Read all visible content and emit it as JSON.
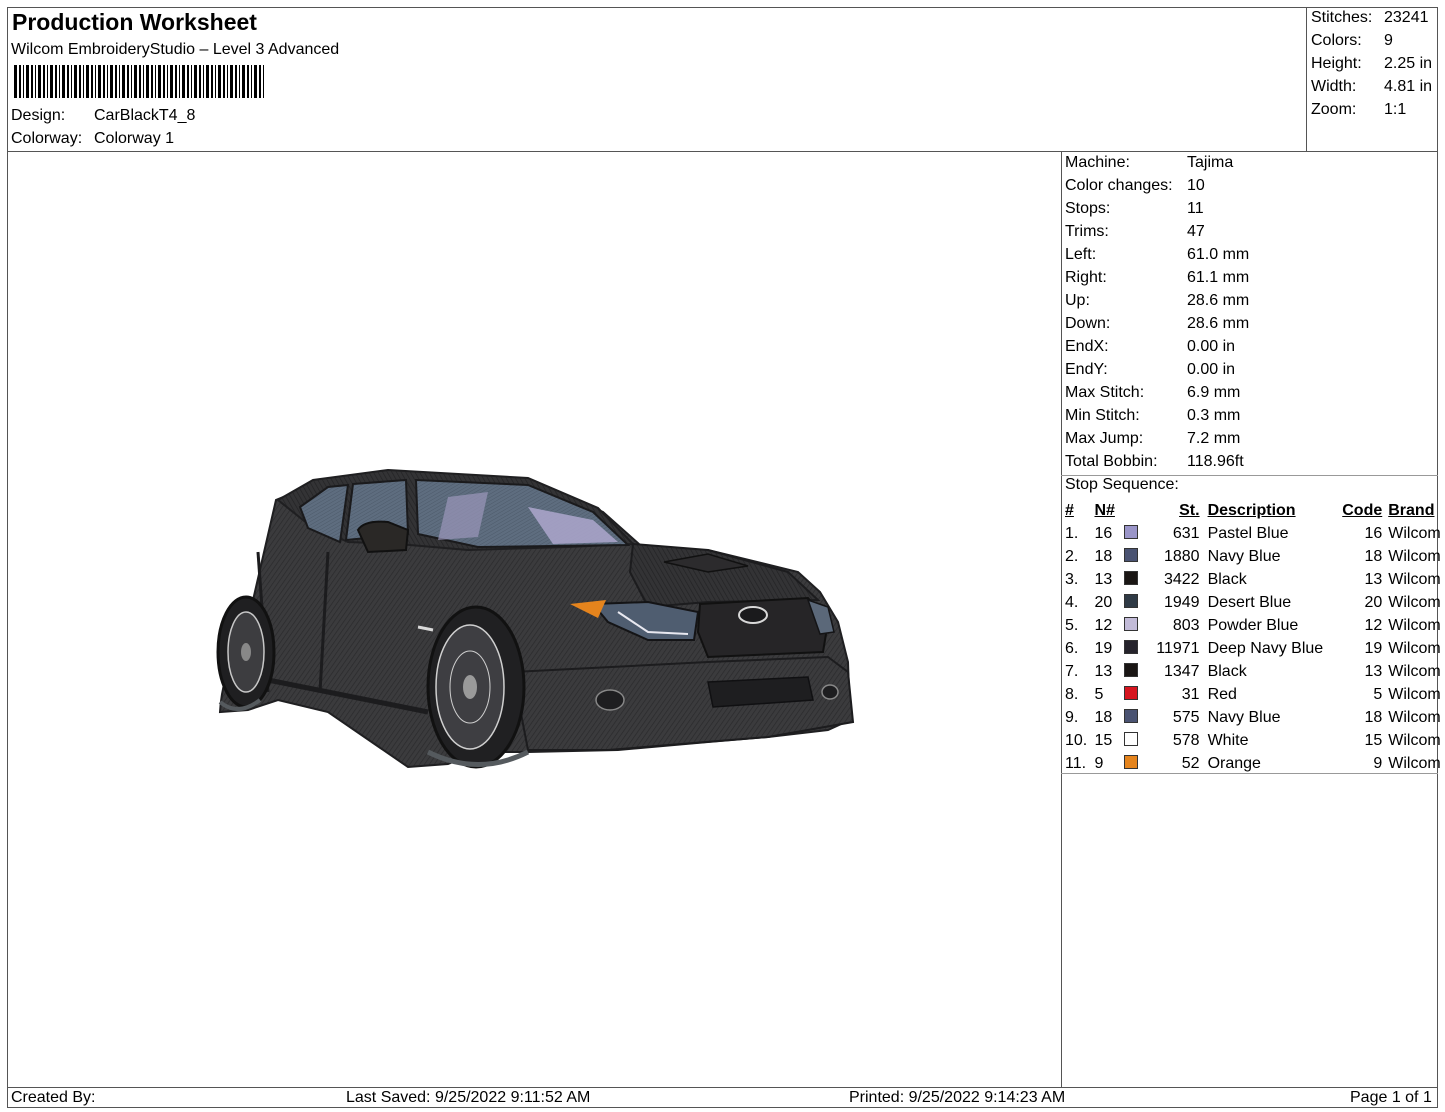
{
  "header": {
    "title": "Production Worksheet",
    "subtitle": "Wilcom EmbroideryStudio – Level 3 Advanced",
    "design_label": "Design:",
    "design_value": "CarBlackT4_8",
    "colorway_label": "Colorway:",
    "colorway_value": "Colorway 1"
  },
  "summary": [
    {
      "label": "Stitches:",
      "value": "23241"
    },
    {
      "label": "Colors:",
      "value": "9"
    },
    {
      "label": "Height:",
      "value": "2.25 in"
    },
    {
      "label": "Width:",
      "value": "4.81 in"
    },
    {
      "label": "Zoom:",
      "value": "1:1"
    }
  ],
  "machine_info": [
    {
      "label": "Machine:",
      "value": "Tajima"
    },
    {
      "label": "Color changes:",
      "value": "10"
    },
    {
      "label": "Stops:",
      "value": "11"
    },
    {
      "label": "Trims:",
      "value": "47"
    },
    {
      "label": "Left:",
      "value": "61.0 mm"
    },
    {
      "label": "Right:",
      "value": "61.1 mm"
    },
    {
      "label": "Up:",
      "value": "28.6 mm"
    },
    {
      "label": "Down:",
      "value": "28.6 mm"
    },
    {
      "label": "EndX:",
      "value": "0.00 in"
    },
    {
      "label": "EndY:",
      "value": "0.00 in"
    },
    {
      "label": "Max Stitch:",
      "value": "6.9 mm"
    },
    {
      "label": "Min Stitch:",
      "value": "0.3 mm"
    },
    {
      "label": "Max Jump:",
      "value": "7.2 mm"
    },
    {
      "label": "Total Bobbin:",
      "value": "118.96ft"
    }
  ],
  "stop_sequence": {
    "label": "Stop Sequence:",
    "headers": {
      "idx": "#",
      "n": "N#",
      "st": "St.",
      "desc": "Description",
      "code": "Code",
      "brand": "Brand"
    },
    "rows": [
      {
        "idx": "1.",
        "n": "16",
        "color": "#9a95c8",
        "st": "631",
        "desc": "Pastel Blue",
        "code": "16",
        "brand": "Wilcom"
      },
      {
        "idx": "2.",
        "n": "18",
        "color": "#4a5372",
        "st": "1880",
        "desc": "Navy Blue",
        "code": "18",
        "brand": "Wilcom"
      },
      {
        "idx": "3.",
        "n": "13",
        "color": "#1a1614",
        "st": "3422",
        "desc": "Black",
        "code": "13",
        "brand": "Wilcom"
      },
      {
        "idx": "4.",
        "n": "20",
        "color": "#2f3a45",
        "st": "1949",
        "desc": "Desert Blue",
        "code": "20",
        "brand": "Wilcom"
      },
      {
        "idx": "5.",
        "n": "12",
        "color": "#c2bbd8",
        "st": "803",
        "desc": "Powder Blue",
        "code": "12",
        "brand": "Wilcom"
      },
      {
        "idx": "6.",
        "n": "19",
        "color": "#25232b",
        "st": "11971",
        "desc": "Deep Navy Blue",
        "code": "19",
        "brand": "Wilcom"
      },
      {
        "idx": "7.",
        "n": "13",
        "color": "#1a1614",
        "st": "1347",
        "desc": "Black",
        "code": "13",
        "brand": "Wilcom"
      },
      {
        "idx": "8.",
        "n": "5",
        "color": "#d6151f",
        "st": "31",
        "desc": "Red",
        "code": "5",
        "brand": "Wilcom"
      },
      {
        "idx": "9.",
        "n": "18",
        "color": "#4a5372",
        "st": "575",
        "desc": "Navy Blue",
        "code": "18",
        "brand": "Wilcom"
      },
      {
        "idx": "10.",
        "n": "15",
        "color": "#ffffff",
        "st": "578",
        "desc": "White",
        "code": "15",
        "brand": "Wilcom"
      },
      {
        "idx": "11.",
        "n": "9",
        "color": "#e5841d",
        "st": "52",
        "desc": "Orange",
        "code": "9",
        "brand": "Wilcom"
      }
    ]
  },
  "footer": {
    "created_by": "Created By:",
    "last_saved": "Last Saved: 9/25/2022 9:11:52 AM",
    "printed": "Printed: 9/25/2022 9:14:23 AM",
    "page": "Page 1 of 1"
  },
  "design_image": {
    "subject": "embroidered black hatchback car",
    "body_color": "#3a3a3c",
    "glass_color": "#5f6e80",
    "interior_color": "#a8a3c9",
    "accent_orange": "#e5841d"
  }
}
